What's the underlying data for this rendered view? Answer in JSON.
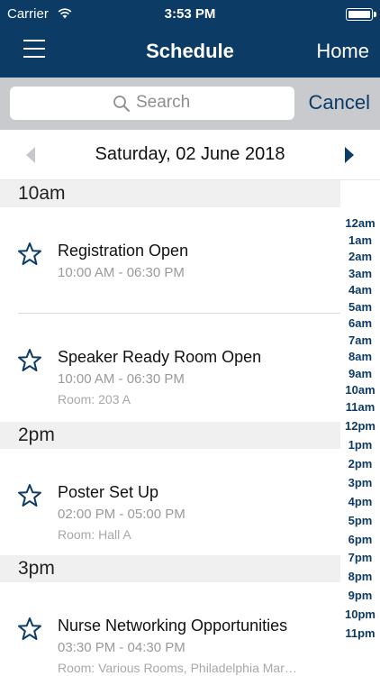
{
  "status_bar": {
    "carrier": "Carrier",
    "time": "3:53 PM"
  },
  "nav": {
    "title": "Schedule",
    "home_label": "Home",
    "menu_icon": "hamburger-icon"
  },
  "search": {
    "placeholder": "Search",
    "value": "",
    "cancel_label": "Cancel"
  },
  "date_bar": {
    "label": "Saturday, 02 June 2018"
  },
  "sections": [
    {
      "label": "10am",
      "events": [
        {
          "title": "Registration Open",
          "time": "10:00 AM - 06:30 PM",
          "room": ""
        },
        {
          "title": "Speaker Ready Room Open",
          "time": "10:00 AM - 06:30 PM",
          "room": "Room: 203 A"
        }
      ]
    },
    {
      "label": "2pm",
      "events": [
        {
          "title": "Poster Set Up",
          "time": "02:00 PM - 05:00 PM",
          "room": "Room: Hall A"
        }
      ]
    },
    {
      "label": "3pm",
      "events": [
        {
          "title": "Nurse Networking Opportunities",
          "time": "03:30 PM - 04:30 PM",
          "room": "Room: Various Rooms, Philadelphia Marriott"
        }
      ]
    }
  ],
  "hour_index": [
    "12am",
    "1am",
    "2am",
    "3am",
    "4am",
    "5am",
    "6am",
    "7am",
    "8am",
    "9am",
    "10am",
    "11am",
    "12pm",
    "1pm",
    "2pm",
    "3pm",
    "4pm",
    "5pm",
    "6pm",
    "7pm",
    "8pm",
    "9pm",
    "10pm",
    "11pm"
  ],
  "colors": {
    "brand": "#0c3b66",
    "section_bg": "#f0f0f0",
    "search_bar_bg": "#c9cace"
  }
}
